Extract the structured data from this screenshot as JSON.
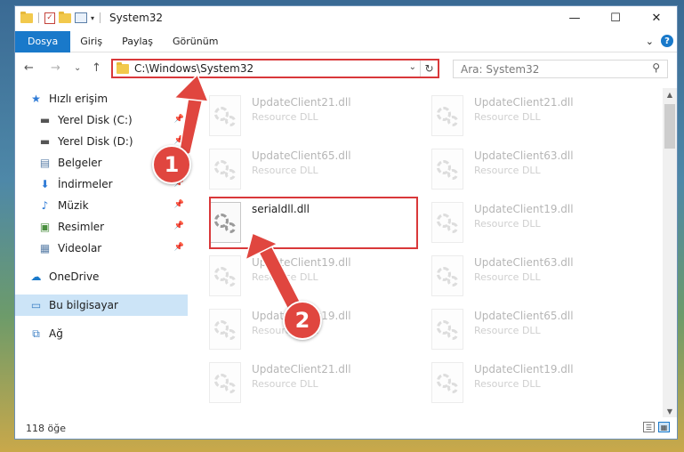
{
  "window": {
    "title": "System32",
    "minimize_glyph": "—",
    "maximize_glyph": "☐",
    "close_glyph": "✕"
  },
  "ribbon": {
    "tabs": [
      {
        "label": "Dosya"
      },
      {
        "label": "Giriş"
      },
      {
        "label": "Paylaş"
      },
      {
        "label": "Görünüm"
      }
    ],
    "expand_glyph": "⌄",
    "help_glyph": "?"
  },
  "nav": {
    "back_glyph": "←",
    "forward_glyph": "→",
    "recent_glyph": "⌄",
    "up_glyph": "↑",
    "address": "C:\\Windows\\System32",
    "address_dropdown_glyph": "⌄",
    "refresh_glyph": "↻",
    "search_placeholder": "Ara: System32",
    "search_icon_glyph": "⚲"
  },
  "sidebar": {
    "items": [
      {
        "label": "Hızlı erişim",
        "icon": "star-icon",
        "glyph": "★",
        "color": "#2f7bd6"
      },
      {
        "label": "Yerel Disk (C:)",
        "icon": "drive-icon",
        "glyph": "▬",
        "color": "#555555",
        "pinned": true
      },
      {
        "label": "Yerel Disk (D:)",
        "icon": "drive-icon",
        "glyph": "▬",
        "color": "#555555",
        "pinned": true
      },
      {
        "label": "Belgeler",
        "icon": "documents-icon",
        "glyph": "▤",
        "color": "#5b7fa8",
        "pinned": true
      },
      {
        "label": "İndirmeler",
        "icon": "download-icon",
        "glyph": "⬇",
        "color": "#2f7bd6",
        "pinned": true
      },
      {
        "label": "Müzik",
        "icon": "music-icon",
        "glyph": "♪",
        "color": "#2f7bd6",
        "pinned": true
      },
      {
        "label": "Resimler",
        "icon": "pictures-icon",
        "glyph": "▣",
        "color": "#4a8f3f",
        "pinned": true
      },
      {
        "label": "Videolar",
        "icon": "videos-icon",
        "glyph": "▦",
        "color": "#5b7fa8",
        "pinned": true
      },
      {
        "label": "OneDrive",
        "icon": "cloud-icon",
        "glyph": "☁",
        "color": "#1979ca"
      },
      {
        "label": "Bu bilgisayar",
        "icon": "computer-icon",
        "glyph": "▭",
        "color": "#3b7fc4",
        "selected": true
      },
      {
        "label": "Ağ",
        "icon": "network-icon",
        "glyph": "⧉",
        "color": "#3b7fc4"
      }
    ],
    "pin_glyph": "📌"
  },
  "files": {
    "type_label": "Resource DLL",
    "left_column": [
      {
        "name": "UpdateClient21.dll",
        "faded": true
      },
      {
        "name": "UpdateClient65.dll",
        "faded": true
      },
      {
        "name": "serialdll.dll",
        "faded": false,
        "highlighted": true
      },
      {
        "name": "UpdateClient19.dll",
        "faded": true
      },
      {
        "name": "UpdateClient19.dll",
        "faded": true
      },
      {
        "name": "UpdateClient21.dll",
        "faded": true
      }
    ],
    "right_column": [
      {
        "name": "UpdateClient21.dll",
        "faded": true
      },
      {
        "name": "UpdateClient63.dll",
        "faded": true
      },
      {
        "name": "UpdateClient19.dll",
        "faded": true
      },
      {
        "name": "UpdateClient63.dll",
        "faded": true
      },
      {
        "name": "UpdateClient65.dll",
        "faded": true
      },
      {
        "name": "UpdateClient19.dll",
        "faded": true
      }
    ]
  },
  "status": {
    "item_count": "118 öğe"
  },
  "callouts": [
    {
      "number": "1",
      "color": "#e0463f"
    },
    {
      "number": "2",
      "color": "#e0463f"
    }
  ],
  "colors": {
    "accent": "#1979ca",
    "highlight_border": "#d9383a",
    "selection": "#cce4f7"
  }
}
